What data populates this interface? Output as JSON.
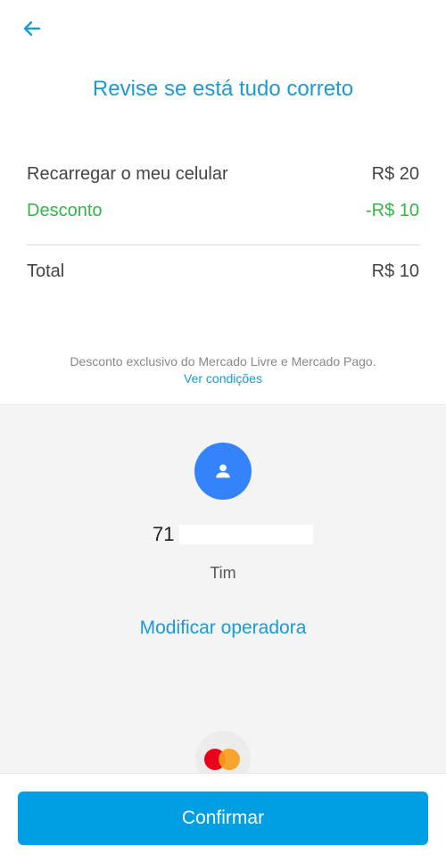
{
  "header": {
    "back_icon": "arrow-left-icon",
    "title": "Revise se está tudo correto"
  },
  "summary": {
    "item_label": "Recarregar o meu celular",
    "item_value": "R$ 20",
    "discount_label": "Desconto",
    "discount_value": "-R$ 10",
    "total_label": "Total",
    "total_value": "R$ 10"
  },
  "note": {
    "text": "Desconto exclusivo do Mercado Livre e Mercado Pago.",
    "link": "Ver condições"
  },
  "recipient": {
    "avatar_icon": "person-icon",
    "phone_prefix": "71",
    "operator": "Tim",
    "modify_link": "Modificar operadora"
  },
  "payment": {
    "card_icon": "mastercard-icon"
  },
  "footer": {
    "confirm_label": "Confirmar"
  },
  "colors": {
    "accent": "#009ee3",
    "link": "#1a9ad6",
    "discount": "#35b34a",
    "avatar": "#3483fa"
  }
}
